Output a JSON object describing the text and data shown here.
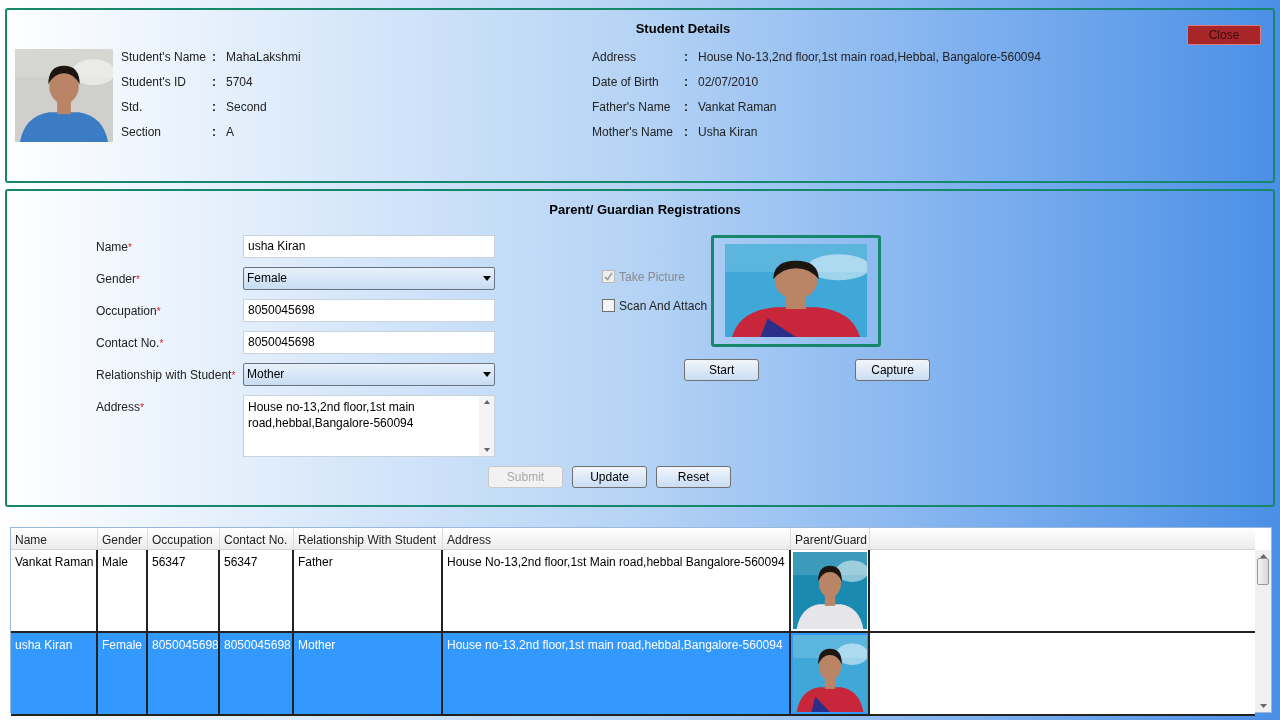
{
  "student_details": {
    "title": "Student Details",
    "close_button": "Close",
    "photo": {
      "kind": "picture"
    },
    "left_fields": [
      {
        "label": "Student's Name",
        "colon": ":",
        "value": "MahaLakshmi"
      },
      {
        "label": "Student's ID",
        "colon": ":",
        "value": "5704"
      },
      {
        "label": "Std.",
        "colon": ":",
        "value": "Second"
      },
      {
        "label": "Section",
        "colon": ":",
        "value": "A"
      }
    ],
    "right_fields": [
      {
        "label": "Address",
        "colon": ":",
        "value": "House No-13,2nd floor,1st main road,Hebbal, Bangalore-560094"
      },
      {
        "label": "Date of Birth",
        "colon": ":",
        "value": "02/07/2010"
      },
      {
        "label": "Father's Name",
        "colon": ":",
        "value": "Vankat Raman"
      },
      {
        "label": "Mother's Name",
        "colon": ":",
        "value": "Usha Kiran"
      }
    ]
  },
  "registration": {
    "title": "Parent/ Guardian Registrations",
    "fields": [
      {
        "kind": "text",
        "label": "Name",
        "required_mark": "*",
        "value": "usha Kiran"
      },
      {
        "kind": "select",
        "label": "Gender",
        "required_mark": "*",
        "value": "Female"
      },
      {
        "kind": "text",
        "label": "Occupation",
        "required_mark": "*",
        "value": "8050045698"
      },
      {
        "kind": "text",
        "label": "Contact No.",
        "required_mark": "*",
        "value": "8050045698"
      },
      {
        "kind": "select",
        "label": "Relationship with Student",
        "required_mark": "*",
        "value": "Mother"
      },
      {
        "kind": "textarea",
        "label": "Address",
        "required_mark": "*",
        "value": "House no-13,2nd floor,1st main road,hebbal,Bangalore-560094"
      }
    ],
    "options": [
      {
        "label": "Take Picture",
        "checked": true,
        "disabled": true
      },
      {
        "label": "Scan And Attach",
        "checked": false,
        "disabled": false
      }
    ],
    "photo": {
      "kind": "picture"
    },
    "camera_buttons": [
      {
        "label": "Start",
        "disabled": false
      },
      {
        "label": "Capture",
        "disabled": false
      }
    ],
    "action_buttons": [
      {
        "label": "Submit",
        "disabled": true
      },
      {
        "label": "Update",
        "disabled": false
      },
      {
        "label": "Reset",
        "disabled": false
      }
    ]
  },
  "table": {
    "columns": [
      "Name",
      "Gender",
      "Occupation",
      "Contact No.",
      "Relationship With Student",
      "Address",
      "Parent/Guard"
    ],
    "rows": [
      {
        "selected": false,
        "cells": [
          "Vankat Raman",
          "Male",
          "56347",
          "56347",
          "Father",
          "House No-13,2nd floor,1st Main road,hebbal Bangalore-560094"
        ],
        "photo": {
          "kind": "picture"
        }
      },
      {
        "selected": true,
        "cells": [
          "usha Kiran",
          "Female",
          "8050045698",
          "8050045698",
          "Mother",
          "House no-13,2nd floor,1st main road,hebbal,Bangalore-560094"
        ],
        "photo": {
          "kind": "picture"
        }
      }
    ]
  }
}
